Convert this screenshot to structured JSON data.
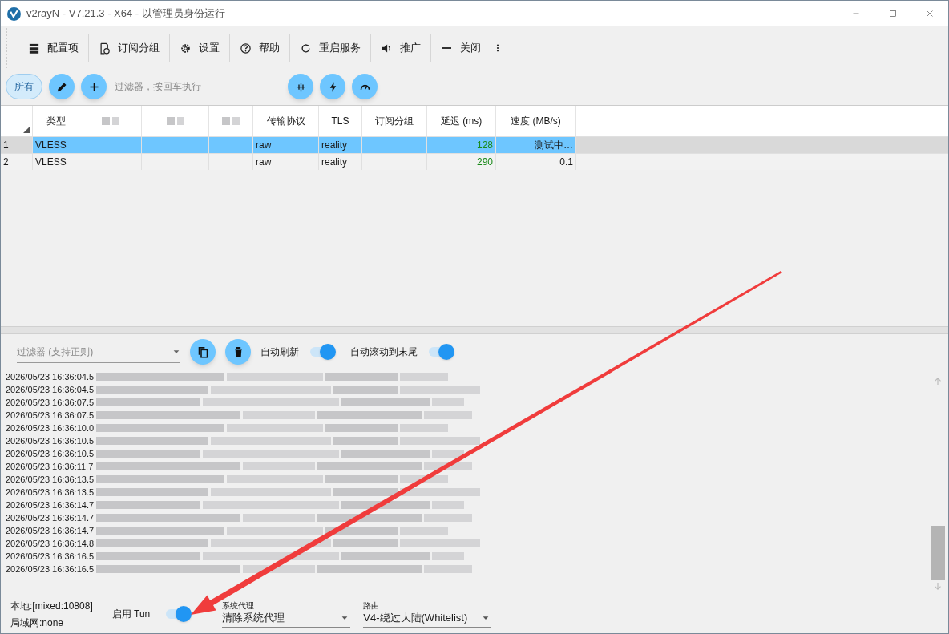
{
  "window": {
    "title": "v2rayN - V7.21.3 - X64 - 以管理员身份运行"
  },
  "toolbar": [
    "配置项",
    "订阅分组",
    "设置",
    "帮助",
    "重启服务",
    "推广",
    "关闭"
  ],
  "filter_bar": {
    "group_tab": {
      "label": "所有",
      "selected": true
    },
    "placeholder": "过滤器，按回车执行"
  },
  "table": {
    "columns": [
      "类型",
      "传输协议",
      "TLS",
      "订阅分组",
      "延迟 (ms)",
      "速度 (MB/s)"
    ],
    "rows": [
      {
        "index": "1",
        "type": "VLESS",
        "transport": "raw",
        "tls": "reality",
        "latency": "128",
        "speed": "测试中…",
        "selected": true
      },
      {
        "index": "2",
        "type": "VLESS",
        "transport": "raw",
        "tls": "reality",
        "latency": "290",
        "speed": "0.1",
        "selected": false
      }
    ]
  },
  "log": {
    "filter_placeholder": "过滤器 (支持正则)",
    "auto_refresh": {
      "label": "自动刷新",
      "on": true
    },
    "auto_scroll": {
      "label": "自动滚动到末尾",
      "on": true
    },
    "lines": [
      "2026/05/23 16:36:04.5",
      "2026/05/23 16:36:04.5",
      "2026/05/23 16:36:07.5",
      "2026/05/23 16:36:07.5",
      "2026/05/23 16:36:10.0",
      "2026/05/23 16:36:10.5",
      "2026/05/23 16:36:10.5",
      "2026/05/23 16:36:11.7",
      "2026/05/23 16:36:13.5",
      "2026/05/23 16:36:13.5",
      "2026/05/23 16:36:14.7",
      "2026/05/23 16:36:14.7",
      "2026/05/23 16:36:14.7",
      "2026/05/23 16:36:14.8",
      "2026/05/23 16:36:16.5",
      "2026/05/23 16:36:16.5"
    ]
  },
  "status_bar": {
    "local": "本地:[mixed:10808]",
    "lan": "局域网:none",
    "tun": {
      "label": "启用 Tun",
      "on": true
    },
    "system_proxy": {
      "label": "系统代理",
      "value": "清除系统代理"
    },
    "routing": {
      "label": "路由",
      "value": "V4-绕过大陆(Whitelist)"
    }
  }
}
